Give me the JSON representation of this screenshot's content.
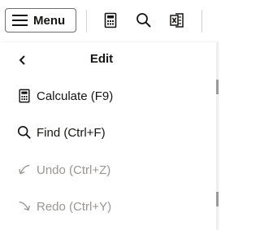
{
  "toolbar": {
    "menu_label": "Menu",
    "icons": [
      "hamburger-icon",
      "calculator-icon",
      "search-icon",
      "excel-export-icon"
    ]
  },
  "panel": {
    "title": "Edit",
    "items": [
      {
        "label": "Calculate (F9)",
        "icon": "calculator-icon",
        "enabled": true
      },
      {
        "label": "Find (Ctrl+F)",
        "icon": "search-icon",
        "enabled": true
      },
      {
        "label": "Undo (Ctrl+Z)",
        "icon": "undo-icon",
        "enabled": false
      },
      {
        "label": "Redo (Ctrl+Y)",
        "icon": "redo-icon",
        "enabled": false
      }
    ]
  },
  "colors": {
    "text": "#161513",
    "disabled_text": "#9a9794",
    "border": "#6f6c69"
  }
}
